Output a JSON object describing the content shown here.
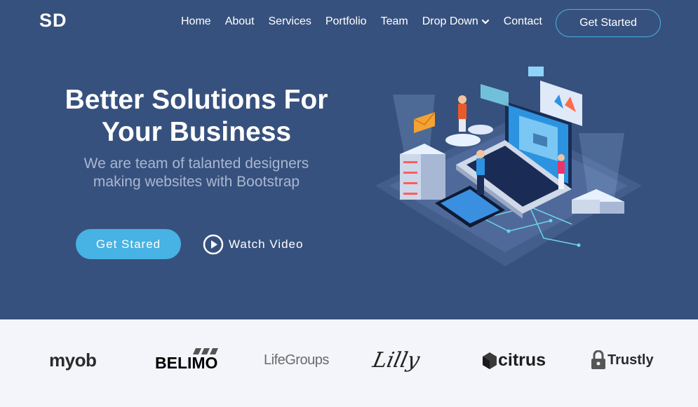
{
  "brand": {
    "logo_text": "SD"
  },
  "nav": {
    "items": [
      "Home",
      "About",
      "Services",
      "Portfolio",
      "Team",
      "Drop Down",
      "Contact"
    ],
    "cta_label": "Get Started"
  },
  "hero": {
    "headline_line1": "Better Solutions For",
    "headline_line2": "Your Business",
    "subtitle_line1": "We are team of talanted designers",
    "subtitle_line2": "making websites with Bootstrap",
    "primary_button": "Get Stared",
    "video_link": "Watch Video",
    "illustration_icon": "isometric-tech-illustration"
  },
  "clients": {
    "logos": [
      "myob",
      "BELIMO",
      "LifeGroups",
      "Lilly",
      "citrus",
      "Trustly"
    ]
  },
  "colors": {
    "hero_bg": "#37517e",
    "accent": "#47b2e4",
    "clients_bg": "#f3f5fa"
  }
}
